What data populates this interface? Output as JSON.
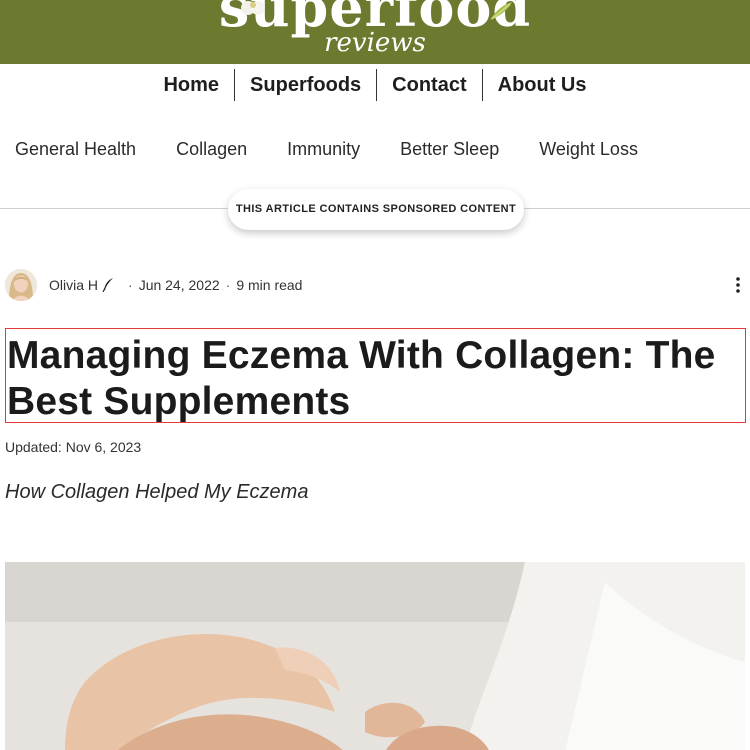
{
  "banner": {
    "logo_top": "superfood",
    "logo_bottom": "reviews",
    "background_color": "#6b7a2e"
  },
  "main_nav": {
    "items": [
      "Home",
      "Superfoods",
      "Contact",
      "About Us"
    ]
  },
  "category_nav": {
    "items": [
      "General Health",
      "Collagen",
      "Immunity",
      "Better Sleep",
      "Weight Loss"
    ]
  },
  "sponsored_notice": "THIS ARTICLE CONTAINS SPONSORED CONTENT",
  "article": {
    "author": "Olivia H",
    "author_badge_icon": "quill-icon",
    "date": "Jun 24, 2022",
    "read_time": "9 min read",
    "more_options_icon": "more-vertical-icon",
    "title": "Managing Eczema With Collagen: The Best Supplements",
    "updated": "Updated: Nov 6, 2023",
    "subtitle": "How Collagen Helped My Eczema"
  },
  "colors": {
    "title_highlight_border": "#e33a3a"
  }
}
